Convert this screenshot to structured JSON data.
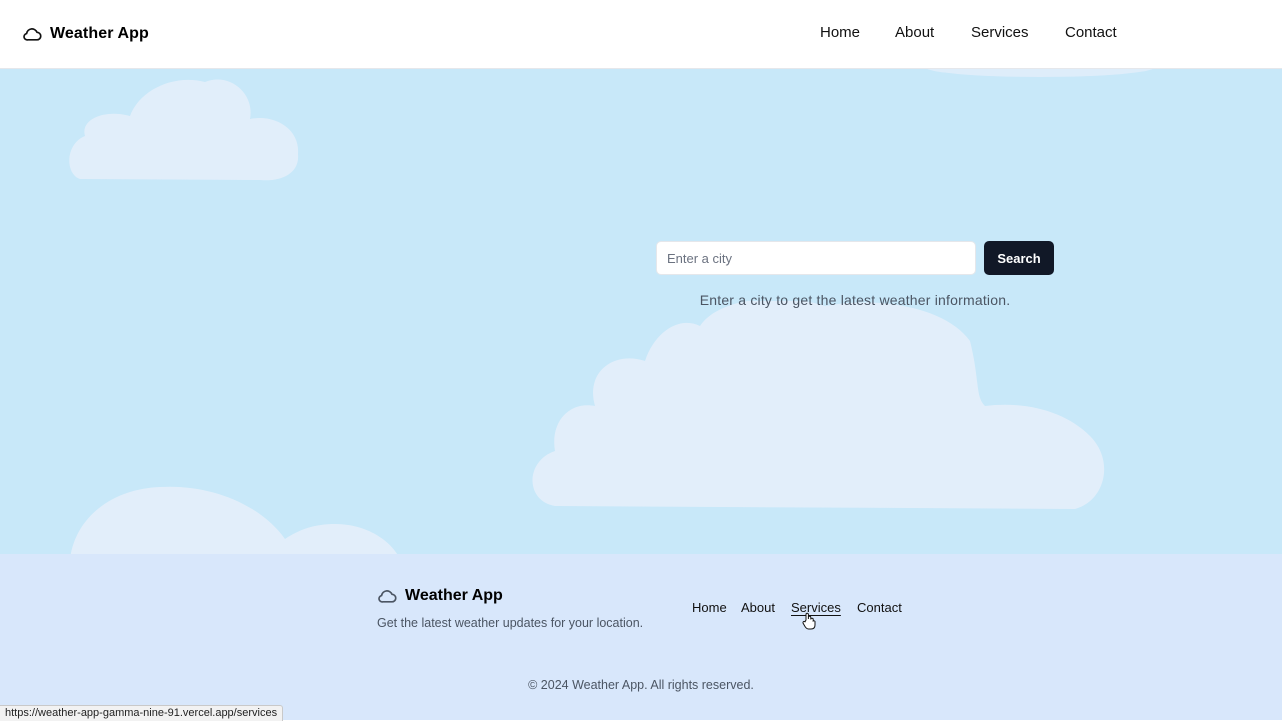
{
  "header": {
    "brand": "Weather App",
    "brand_icon": "cloud-icon",
    "nav": [
      "Home",
      "About",
      "Services",
      "Contact"
    ]
  },
  "hero": {
    "search_placeholder": "Enter a city",
    "search_value": "",
    "search_button": "Search",
    "hint": "Enter a city to get the latest weather information."
  },
  "footer": {
    "brand": "Weather App",
    "brand_icon": "cloud-icon",
    "tagline": "Get the latest weather updates for your location.",
    "nav": [
      "Home",
      "About",
      "Services",
      "Contact"
    ],
    "hovered_nav": "Services",
    "copyright": "© 2024 Weather App. All rights reserved."
  },
  "status_url": "https://weather-app-gamma-nine-91.vercel.app/services",
  "colors": {
    "hero_bg": "#c8e8f9",
    "footer_bg": "#d8e7fb",
    "button_bg": "#111827",
    "cloud_fill": "#e3eefa"
  }
}
